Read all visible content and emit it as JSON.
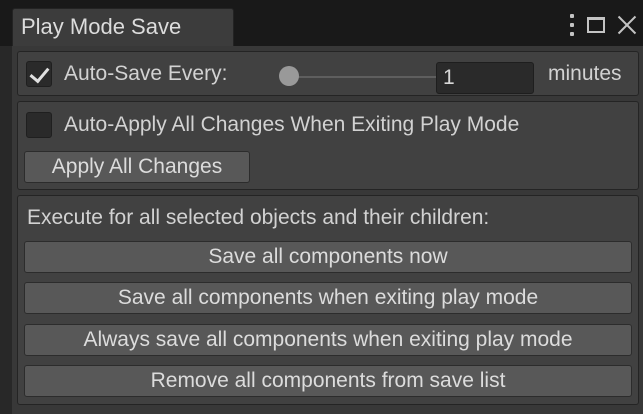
{
  "window": {
    "tab_title": "Play Mode Save"
  },
  "autosave": {
    "checked": true,
    "label": "Auto-Save Every:",
    "value": "1",
    "slider_level": 0,
    "unit": "minutes"
  },
  "autoapply": {
    "checked": false,
    "label": "Auto-Apply All Changes When Exiting Play Mode",
    "apply_button": "Apply All Changes"
  },
  "execute": {
    "heading": "Execute for all selected objects and their children:",
    "buttons": [
      "Save all components now",
      "Save all components when exiting play mode",
      "Always save all components when exiting play mode",
      "Remove all components from save list"
    ]
  },
  "icons": [
    "kebab-menu-icon",
    "maximize-icon",
    "close-icon",
    "checkmark-icon"
  ]
}
